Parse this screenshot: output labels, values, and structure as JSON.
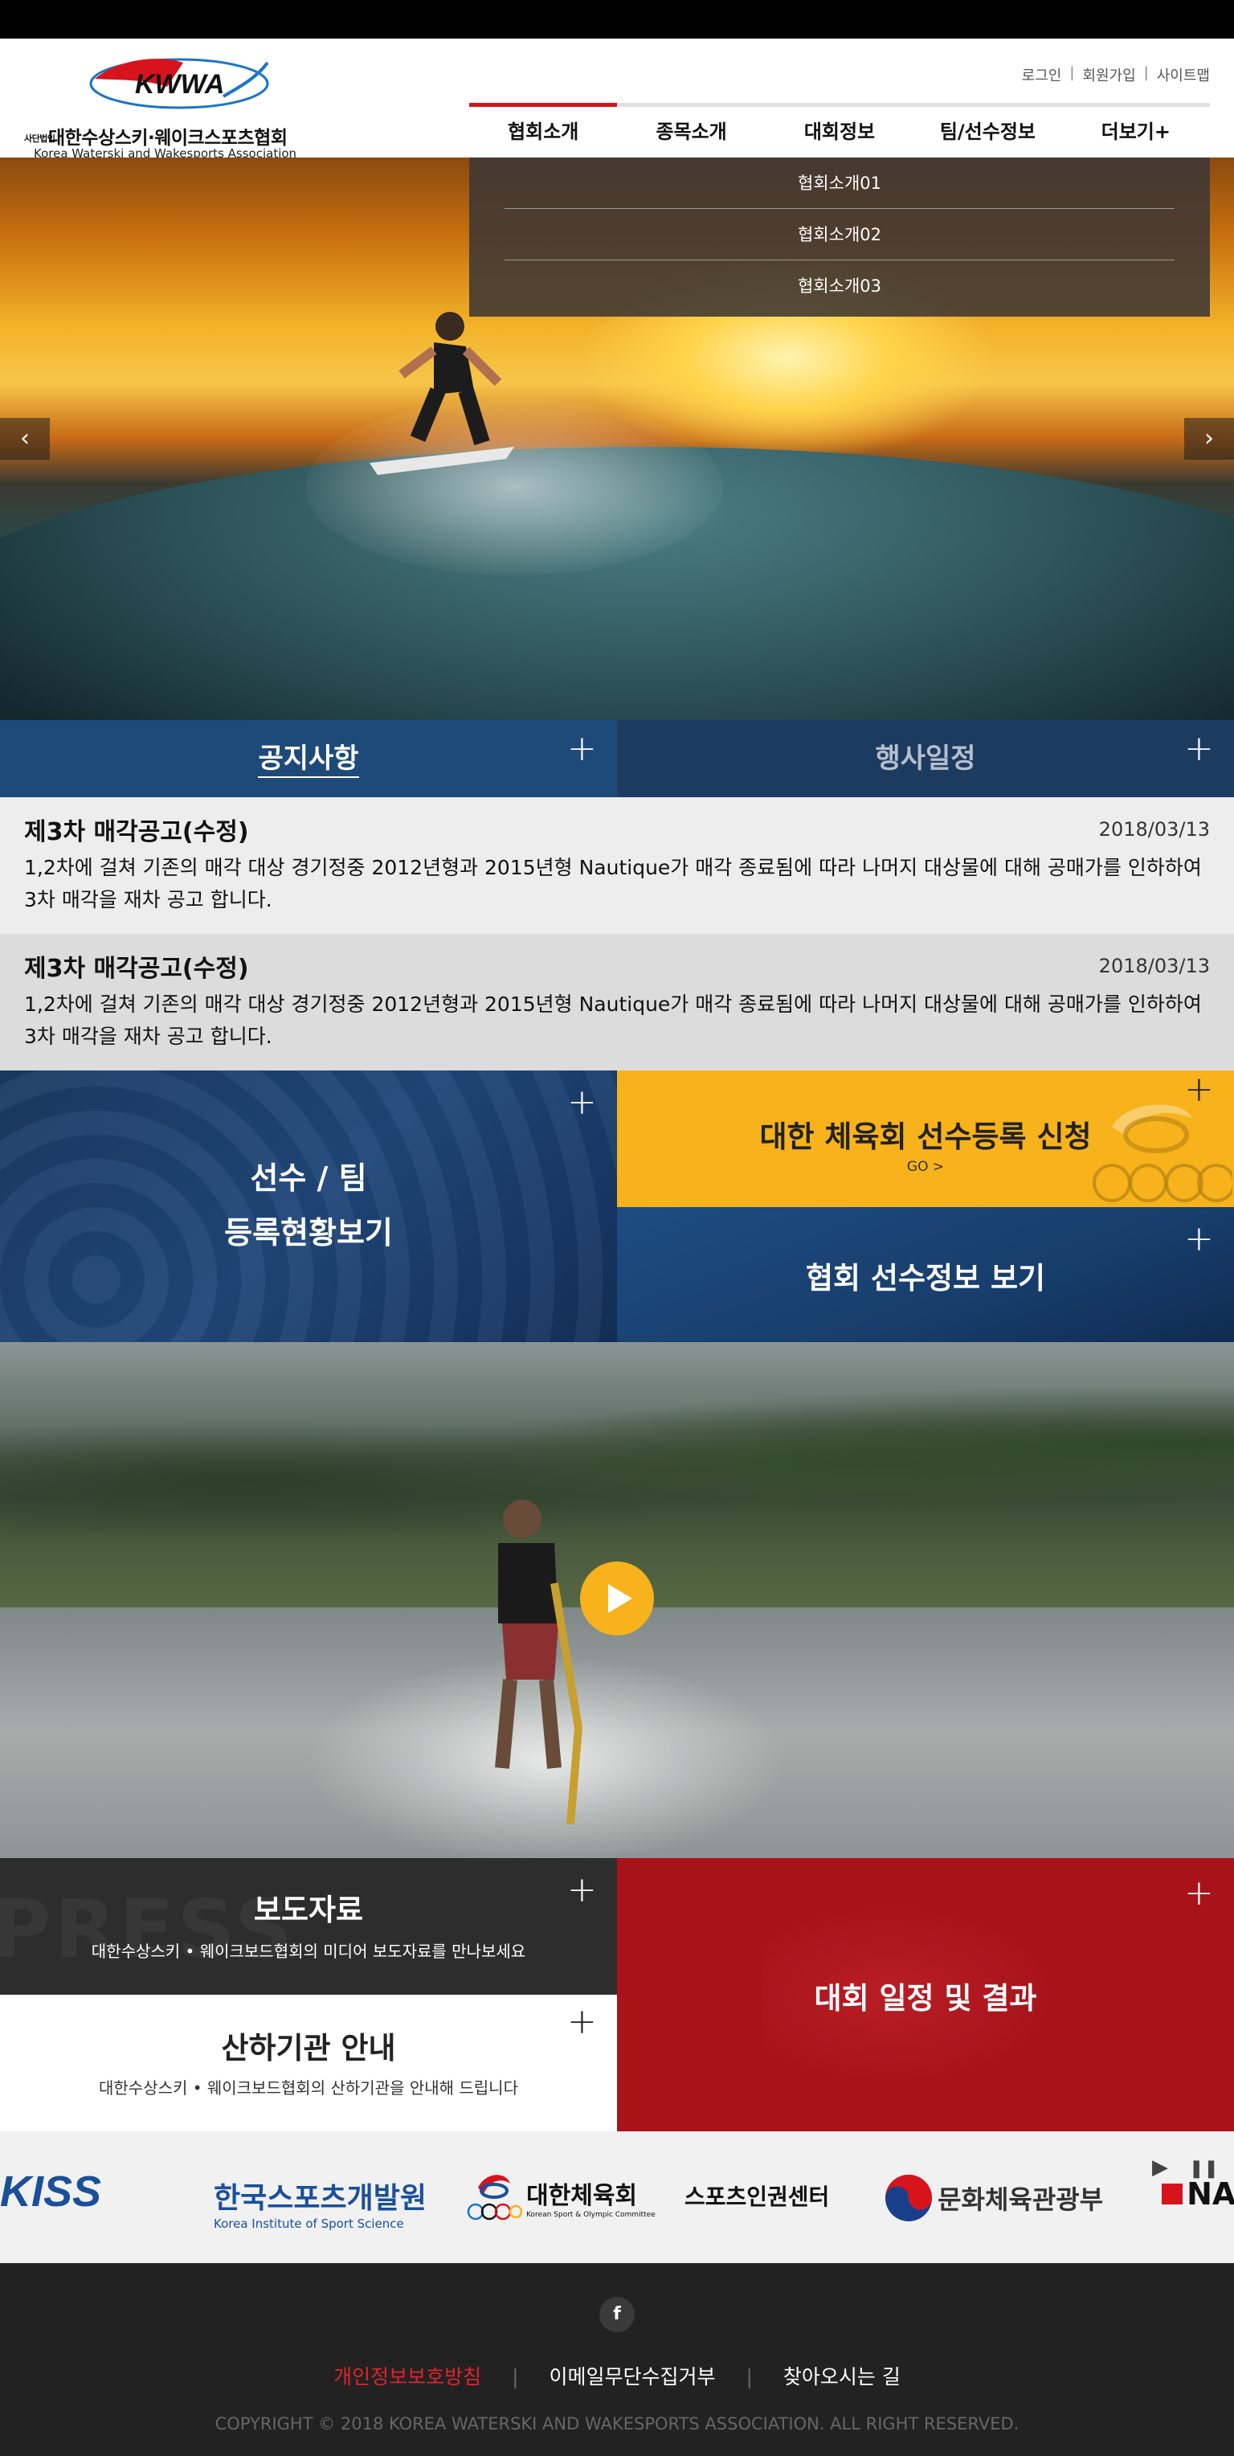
{
  "header": {
    "logo_mark": "KWWA",
    "org_prefix": "사단법인",
    "org_name_kr": "대한수상스키·웨이크스포츠협회",
    "org_name_en": "Korea Waterski and Wakesports Association",
    "util": [
      "로그인",
      "회원가입",
      "사이트맵"
    ],
    "gnb": [
      "협회소개",
      "종목소개",
      "대회정보",
      "팀/선수정보",
      "더보기+"
    ]
  },
  "submenu": [
    "협회소개01",
    "협회소개02",
    "협회소개03"
  ],
  "hero": {
    "prev": "‹",
    "next": "›"
  },
  "tabs": {
    "notice": "공지사항",
    "event": "행사일정",
    "plus": "+"
  },
  "news": [
    {
      "title": "제3차 매각공고(수정)",
      "date": "2018/03/13",
      "body": "1,2차에 걸쳐 기존의 매각 대상 경기정중 2012년형과 2015년형 Nautique가 매각 종료됨에 따라 나머지 대상물에 대해 공매가를 인하하여 3차 매각을 재차 공고 합니다."
    },
    {
      "title": "제3차 매각공고(수정)",
      "date": "2018/03/13",
      "body": "1,2차에 걸쳐 기존의 매각 대상 경기정중 2012년형과 2015년형 Nautique가 매각 종료됨에 따라 나머지 대상물에 대해 공매가를 인하하여 3차 매각을 재차 공고 합니다."
    }
  ],
  "quick": {
    "reg_line1": "선수 / 팀",
    "reg_line2": "등록현황보기",
    "kor_title": "대한 체육회 선수등록 신청",
    "kor_go": "GO >",
    "player_title": "협회 선수정보 보기"
  },
  "press": {
    "bg": "PRESS",
    "title": "보도자료",
    "desc": "대한수상스키 • 웨이크보드협회의 미디어 보도자료를 만나보세요"
  },
  "org": {
    "title": "산하기관 안내",
    "desc": "대한수상스키 • 웨이크보드협회의 산하기관을 안내해 드립니다"
  },
  "competition": {
    "title": "대회 일정 및 결과"
  },
  "partners": {
    "kiss": "KISS",
    "kiss_kr": "한국스포츠개발원",
    "kiss_en": "Korea Institute of Sport Science",
    "koc": "대한체육회",
    "koc_en": "Korean Sport & Olympic Committee",
    "rights": "스포츠인권센터",
    "mcst": "문화체육관광부",
    "na": "NA",
    "play": "▶",
    "pause": "❚❚"
  },
  "footer": {
    "fb": "f",
    "links": [
      "개인정보보호방침",
      "이메일무단수집거부",
      "찾아오시는 길"
    ],
    "copyright": "COPYRIGHT © 2018 KOREA WATERSKI AND WAKESPORTS ASSOCIATION. ALL RIGHT RESERVED."
  },
  "colors": {
    "brand_red": "#d7141c",
    "navy": "#1e4a79",
    "yellow": "#f7b21c",
    "dark_red": "#a8131a"
  }
}
